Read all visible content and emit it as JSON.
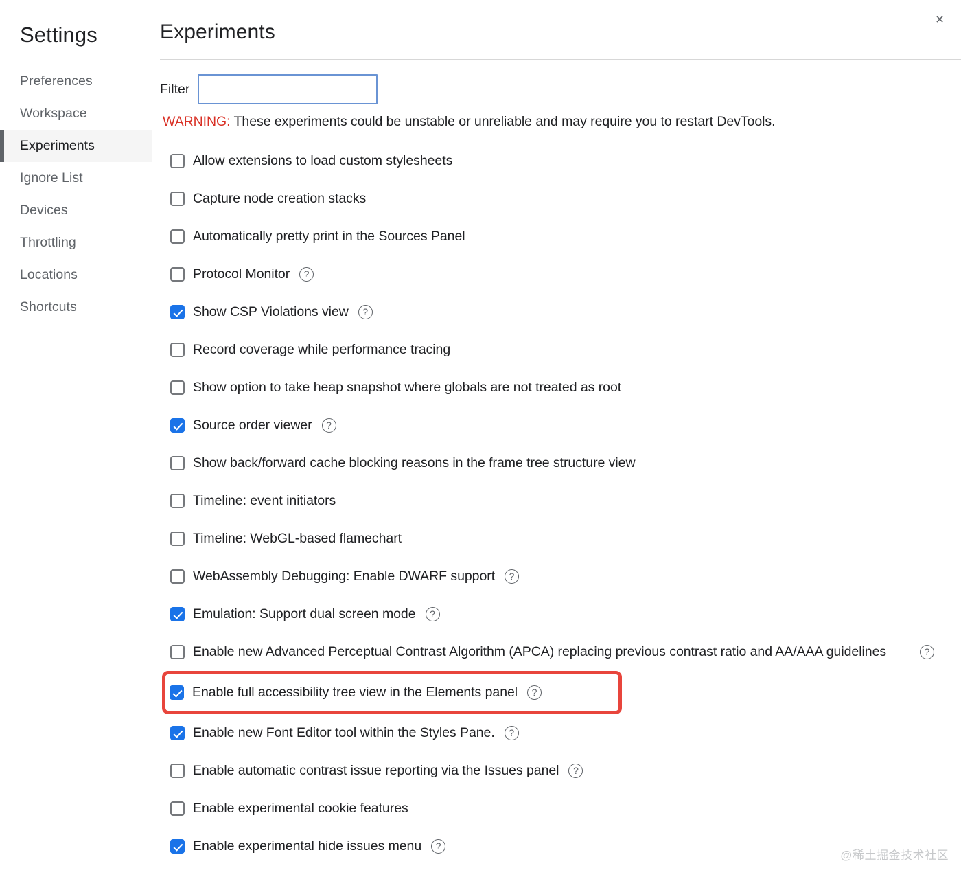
{
  "window": {
    "close_label": "×"
  },
  "sidebar": {
    "title": "Settings",
    "items": [
      {
        "label": "Preferences",
        "active": false
      },
      {
        "label": "Workspace",
        "active": false
      },
      {
        "label": "Experiments",
        "active": true
      },
      {
        "label": "Ignore List",
        "active": false
      },
      {
        "label": "Devices",
        "active": false
      },
      {
        "label": "Throttling",
        "active": false
      },
      {
        "label": "Locations",
        "active": false
      },
      {
        "label": "Shortcuts",
        "active": false
      }
    ]
  },
  "main": {
    "title": "Experiments",
    "filter": {
      "label": "Filter",
      "value": "",
      "placeholder": ""
    },
    "warning": {
      "label": "WARNING:",
      "text": " These experiments could be unstable or unreliable and may require you to restart DevTools.",
      "label_color": "#d93025"
    },
    "experiments": [
      {
        "label": "Allow extensions to load custom stylesheets",
        "checked": false,
        "help": false
      },
      {
        "label": "Capture node creation stacks",
        "checked": false,
        "help": false
      },
      {
        "label": "Automatically pretty print in the Sources Panel",
        "checked": false,
        "help": false
      },
      {
        "label": "Protocol Monitor",
        "checked": false,
        "help": true
      },
      {
        "label": "Show CSP Violations view",
        "checked": true,
        "help": true
      },
      {
        "label": "Record coverage while performance tracing",
        "checked": false,
        "help": false
      },
      {
        "label": "Show option to take heap snapshot where globals are not treated as root",
        "checked": false,
        "help": false
      },
      {
        "label": "Source order viewer",
        "checked": true,
        "help": true
      },
      {
        "label": "Show back/forward cache blocking reasons in the frame tree structure view",
        "checked": false,
        "help": false
      },
      {
        "label": "Timeline: event initiators",
        "checked": false,
        "help": false
      },
      {
        "label": "Timeline: WebGL-based flamechart",
        "checked": false,
        "help": false
      },
      {
        "label": "WebAssembly Debugging: Enable DWARF support",
        "checked": false,
        "help": true
      },
      {
        "label": "Emulation: Support dual screen mode",
        "checked": true,
        "help": true
      },
      {
        "label": "Enable new Advanced Perceptual Contrast Algorithm (APCA) replacing previous contrast ratio and AA/AAA guidelines",
        "checked": false,
        "help": true,
        "help_far_right": true,
        "two_line": true
      },
      {
        "label": "Enable full accessibility tree view in the Elements panel",
        "checked": true,
        "help": true,
        "highlighted": true
      },
      {
        "label": "Enable new Font Editor tool within the Styles Pane.",
        "checked": true,
        "help": true
      },
      {
        "label": "Enable automatic contrast issue reporting via the Issues panel",
        "checked": false,
        "help": true
      },
      {
        "label": "Enable experimental cookie features",
        "checked": false,
        "help": false
      },
      {
        "label": "Enable experimental hide issues menu",
        "checked": true,
        "help": true
      }
    ],
    "help_icon_glyph": "?"
  },
  "watermark": {
    "text": "@稀土掘金技术社区"
  },
  "colors": {
    "accent": "#1a73e8",
    "warning": "#d93025",
    "highlight_border": "#e8453c",
    "active_bar": "#5f6368",
    "active_bg": "#f5f5f5"
  }
}
